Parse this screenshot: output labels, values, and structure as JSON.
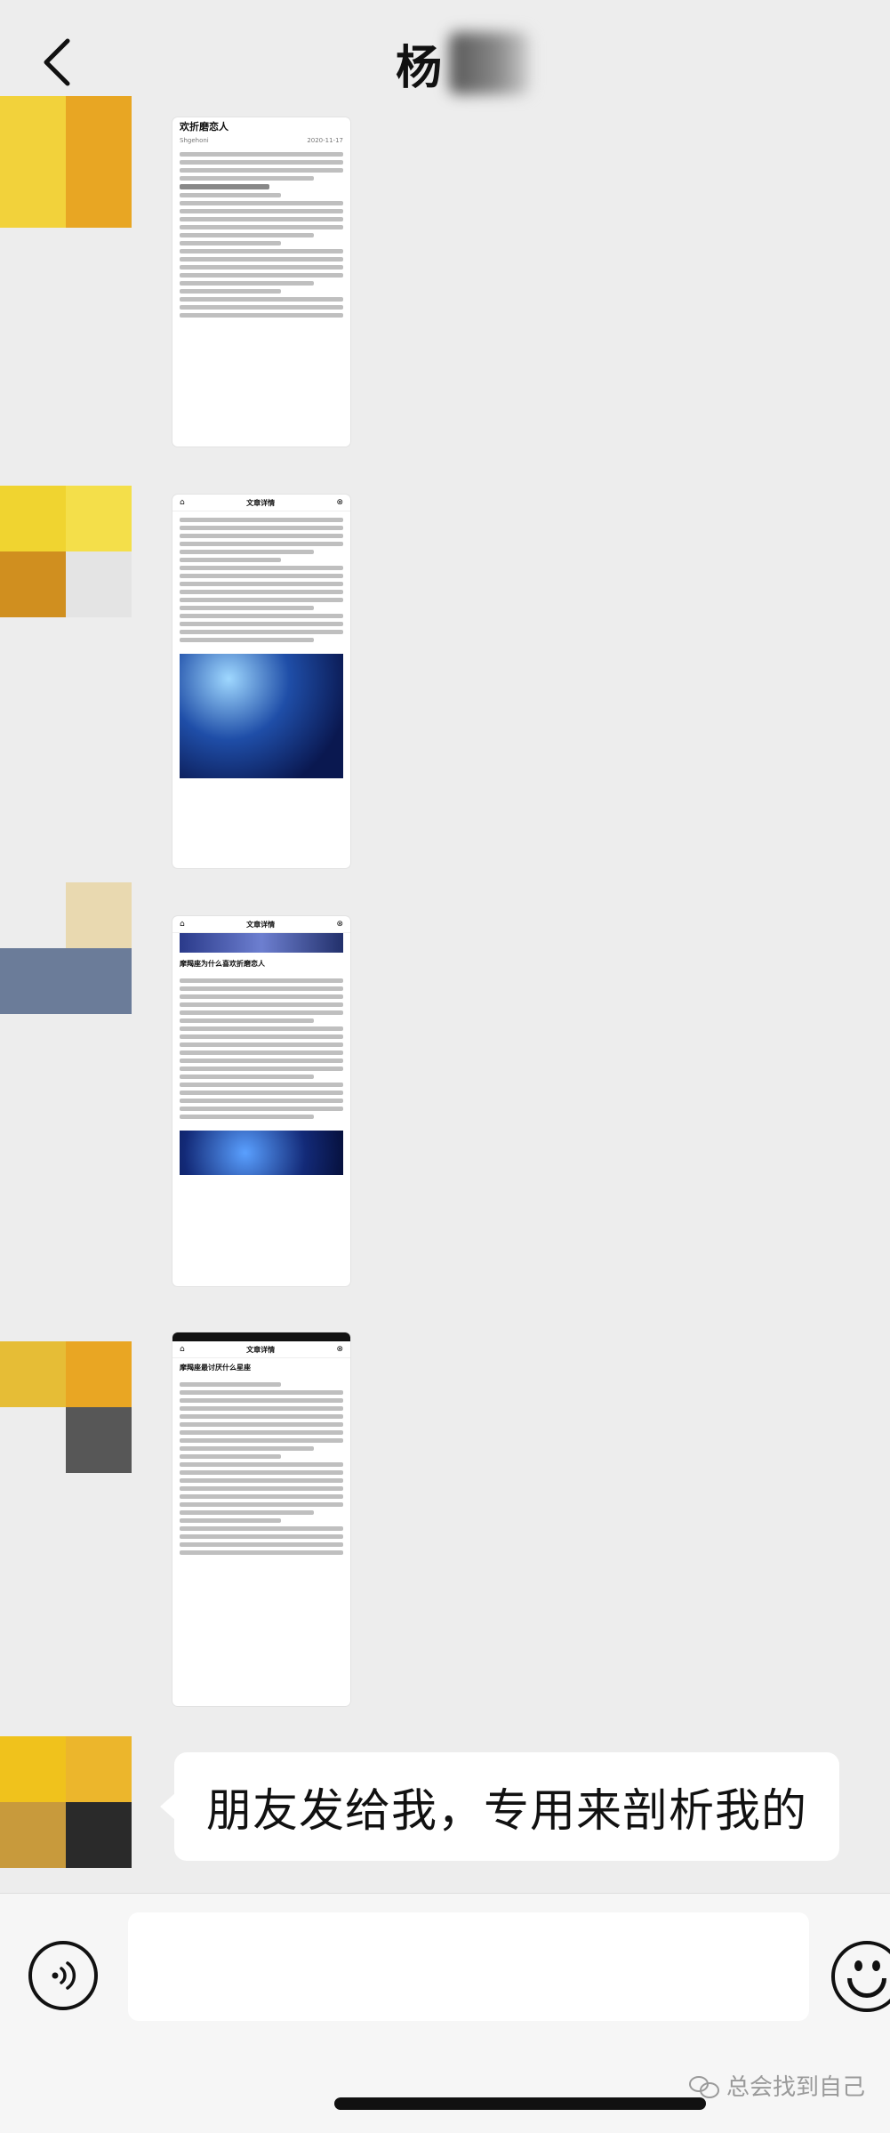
{
  "header": {
    "back_icon": "chevron-left-icon",
    "title": "杨"
  },
  "messages": [
    {
      "type": "image",
      "caption": "article screenshot 1",
      "art_title": "欢折磨恋人",
      "author": "Shgehoni",
      "date": "2020-11-17",
      "avatar_colors": [
        "#f2d23b",
        "#e8a623",
        "#f2d23b",
        "#e8a623"
      ]
    },
    {
      "type": "image",
      "caption": "article screenshot 2",
      "header_title": "文章详情",
      "avatar_colors": [
        "#f0d430",
        "#f4df4a",
        "#d08f1f",
        "#e4e4e4"
      ]
    },
    {
      "type": "image",
      "caption": "article screenshot 3",
      "header_title": "文章详情",
      "section_title": "摩羯座为什么喜欢折磨恋人",
      "avatar_colors": [
        "#ededed",
        "#e9d9b0",
        "#6b7c99",
        "#6b7c99"
      ]
    },
    {
      "type": "image",
      "caption": "article screenshot 4",
      "header_title": "文章详情",
      "section_title": "摩羯座最讨厌什么星座",
      "avatar_colors": [
        "#e6bd36",
        "#e9a623",
        "#ededed",
        "#575757"
      ]
    },
    {
      "type": "text",
      "text": "朋友发给我，专用来剖析我的",
      "avatar_colors": [
        "#f0c21c",
        "#ecb62c",
        "#c89a3c",
        "#2a2a2a"
      ]
    }
  ],
  "composer": {
    "voice_icon": "voice-input-icon",
    "input_value": "",
    "emoji_icon": "emoji-icon"
  },
  "watermark": {
    "icon": "wechat-icon",
    "text": "总会找到自己"
  }
}
